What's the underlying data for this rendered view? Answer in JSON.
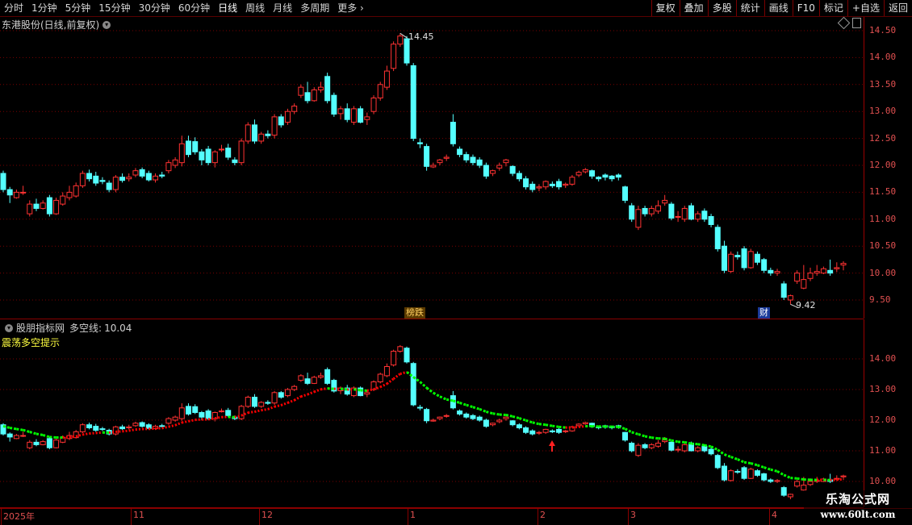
{
  "toolbar": {
    "periods": [
      "分时",
      "1分钟",
      "5分钟",
      "15分钟",
      "30分钟",
      "60分钟",
      "日线",
      "周线",
      "月线",
      "多周期",
      "更多"
    ],
    "active": "日线",
    "right_buttons": [
      "复权",
      "叠加",
      "多股",
      "统计",
      "画线",
      "F10",
      "标记",
      "+自选",
      "返回"
    ]
  },
  "main": {
    "title": "东港股份(日线,前复权)",
    "high_label": "14.45",
    "low_label": "9.42",
    "tag_limit": "榜跌",
    "tag_fin": "财",
    "y_ticks": [
      "14.50",
      "14.00",
      "13.50",
      "13.00",
      "12.50",
      "12.00",
      "11.50",
      "11.00",
      "10.50",
      "10.00",
      "9.50"
    ]
  },
  "indicator": {
    "name": "股朋指标网",
    "line_label": "多空线:",
    "line_value": "10.04",
    "subtitle": "震荡多空提示",
    "y_ticks": [
      "14.00",
      "13.00",
      "12.00",
      "11.00",
      "10.00"
    ]
  },
  "xaxis": {
    "labels": [
      "2025年",
      "11",
      "12",
      "1",
      "2",
      "3",
      "4"
    ]
  },
  "watermark": {
    "line1": "乐淘公式网",
    "line2": "www.60lt.com"
  },
  "colors": {
    "up": "#ff3232",
    "down": "#54ffff",
    "grid": "#7a0000",
    "bull": "#ff0000",
    "bear": "#00ff00"
  },
  "chart_data": {
    "type": "candlestick",
    "x": [
      1,
      2,
      3,
      4,
      5,
      6,
      7,
      8,
      9,
      10,
      11,
      12,
      13,
      14,
      15,
      16,
      17,
      18,
      19,
      20,
      21,
      22,
      23,
      24,
      25,
      26,
      27,
      28,
      29,
      30,
      31,
      32,
      33,
      34,
      35,
      36,
      37,
      38,
      39,
      40,
      41,
      42,
      43,
      44,
      45,
      46,
      47,
      48,
      49,
      50,
      51,
      52,
      53,
      54,
      55,
      56,
      57,
      58,
      59,
      60,
      61,
      62,
      63,
      64,
      65,
      66,
      67,
      68,
      69,
      70,
      71,
      72,
      73,
      74,
      75,
      76,
      77,
      78,
      79,
      80,
      81,
      82,
      83,
      84,
      85,
      86,
      87,
      88,
      89,
      90,
      91,
      92,
      93,
      94,
      95,
      96,
      97,
      98,
      99,
      100,
      101,
      102,
      103,
      104,
      105,
      106,
      107,
      108,
      109,
      110,
      111,
      112,
      113,
      114,
      115,
      116,
      117,
      118,
      119,
      120,
      121,
      122,
      123,
      124,
      125,
      126,
      127,
      128
    ],
    "open": [
      11.85,
      11.55,
      11.4,
      11.5,
      11.1,
      11.28,
      11.2,
      11.4,
      11.1,
      11.28,
      11.4,
      11.43,
      11.62,
      11.85,
      11.8,
      11.72,
      11.67,
      11.55,
      11.78,
      11.75,
      11.82,
      11.92,
      11.85,
      11.73,
      11.82,
      11.9,
      12.0,
      12.05,
      12.45,
      12.44,
      12.25,
      12.3,
      12.05,
      12.3,
      12.32,
      12.1,
      12.05,
      12.45,
      12.75,
      12.45,
      12.58,
      12.56,
      12.9,
      12.8,
      13.0,
      13.3,
      13.35,
      13.2,
      13.4,
      13.65,
      13.3,
      12.96,
      13.05,
      12.8,
      13.05,
      12.85,
      13.0,
      13.25,
      13.45,
      13.8,
      14.25,
      14.35,
      13.85,
      12.42,
      12.35,
      11.97,
      12.05,
      12.13,
      12.8,
      12.3,
      12.2,
      12.15,
      12.1,
      12.0,
      11.85,
      11.95,
      12.05,
      11.98,
      11.85,
      11.75,
      11.65,
      11.58,
      11.6,
      11.65,
      11.7,
      11.63,
      11.65,
      11.82,
      11.88,
      11.9,
      11.78,
      11.82,
      11.8,
      11.82,
      11.6,
      11.25,
      10.85,
      11.2,
      11.1,
      11.15,
      11.3,
      11.28,
      11.05,
      11.0,
      11.25,
      11.0,
      11.15,
      11.05,
      10.85,
      10.5,
      10.03,
      10.33,
      10.45,
      10.1,
      10.35,
      10.25,
      10.05,
      10.0,
      9.8,
      9.5,
      9.85,
      9.72,
      9.9,
      10.0,
      10.0,
      10.05,
      10.08,
      10.15
    ],
    "close": [
      11.55,
      11.45,
      11.5,
      11.5,
      11.28,
      11.2,
      11.3,
      11.1,
      11.35,
      11.43,
      11.5,
      11.62,
      11.85,
      11.75,
      11.67,
      11.7,
      11.55,
      11.78,
      11.72,
      11.78,
      11.9,
      11.8,
      11.73,
      11.8,
      11.8,
      12.05,
      12.1,
      12.4,
      12.2,
      12.25,
      12.1,
      12.05,
      12.25,
      12.3,
      12.15,
      12.05,
      12.45,
      12.75,
      12.45,
      12.58,
      12.55,
      12.9,
      12.75,
      13.0,
      13.1,
      13.45,
      13.2,
      13.4,
      13.45,
      13.2,
      12.95,
      13.05,
      12.85,
      13.05,
      12.8,
      12.9,
      13.25,
      13.5,
      13.75,
      14.25,
      14.4,
      13.9,
      12.5,
      12.4,
      11.98,
      12.0,
      12.1,
      12.15,
      12.4,
      12.2,
      12.1,
      12.05,
      12.0,
      11.8,
      11.9,
      12.0,
      12.1,
      11.85,
      11.75,
      11.6,
      11.55,
      11.6,
      11.7,
      11.62,
      11.6,
      11.65,
      11.78,
      11.87,
      11.92,
      11.8,
      11.75,
      11.78,
      11.75,
      11.78,
      11.35,
      11.0,
      11.18,
      11.1,
      11.2,
      11.25,
      11.35,
      11.02,
      11.05,
      11.2,
      11.0,
      11.1,
      11.0,
      10.9,
      10.45,
      10.05,
      10.35,
      10.3,
      10.1,
      10.4,
      10.2,
      10.05,
      10.0,
      10.03,
      9.55,
      9.58,
      10.0,
      9.88,
      10.0,
      10.03,
      10.08,
      10.0,
      10.1,
      10.18
    ],
    "high": [
      11.9,
      11.6,
      11.55,
      11.62,
      11.35,
      11.38,
      11.35,
      11.45,
      11.4,
      11.5,
      11.62,
      11.68,
      11.9,
      11.92,
      11.88,
      11.78,
      11.72,
      11.82,
      11.85,
      11.85,
      11.95,
      11.96,
      11.9,
      11.85,
      11.88,
      12.1,
      12.15,
      12.55,
      12.55,
      12.52,
      12.3,
      12.36,
      12.28,
      12.38,
      12.4,
      12.15,
      12.5,
      12.8,
      12.85,
      12.62,
      12.65,
      12.95,
      12.95,
      13.05,
      13.15,
      13.5,
      13.55,
      13.45,
      13.55,
      13.72,
      13.35,
      13.1,
      13.15,
      13.1,
      13.1,
      12.98,
      13.3,
      13.55,
      13.85,
      14.3,
      14.45,
      14.4,
      13.9,
      12.5,
      12.4,
      12.05,
      12.12,
      12.2,
      12.95,
      12.35,
      12.25,
      12.2,
      12.15,
      12.05,
      11.92,
      12.05,
      12.12,
      12.0,
      11.9,
      11.8,
      11.7,
      11.65,
      11.72,
      11.7,
      11.75,
      11.68,
      11.82,
      11.9,
      11.95,
      11.92,
      11.8,
      11.85,
      11.82,
      11.85,
      11.62,
      11.3,
      11.25,
      11.25,
      11.25,
      11.35,
      11.45,
      11.32,
      11.15,
      11.25,
      11.3,
      11.15,
      11.2,
      11.1,
      10.9,
      10.6,
      10.4,
      10.4,
      10.5,
      10.45,
      10.4,
      10.28,
      10.1,
      10.08,
      9.85,
      9.6,
      10.05,
      10.15,
      10.1,
      10.15,
      10.12,
      10.25,
      10.2,
      10.22
    ],
    "low": [
      11.5,
      11.3,
      11.38,
      11.45,
      11.05,
      11.15,
      11.18,
      11.05,
      11.08,
      11.25,
      11.35,
      11.4,
      11.58,
      11.7,
      11.62,
      11.65,
      11.5,
      11.5,
      11.68,
      11.7,
      11.78,
      11.76,
      11.7,
      11.68,
      11.76,
      11.85,
      11.95,
      11.98,
      12.15,
      12.2,
      12.0,
      12.0,
      11.96,
      12.25,
      12.1,
      12.0,
      12.0,
      12.4,
      12.4,
      12.4,
      12.5,
      12.5,
      12.7,
      12.75,
      12.95,
      13.25,
      13.15,
      13.18,
      13.35,
      13.15,
      12.9,
      12.85,
      12.8,
      12.75,
      12.78,
      12.75,
      12.95,
      13.2,
      13.4,
      13.75,
      14.2,
      13.85,
      12.45,
      12.32,
      11.9,
      11.95,
      12.0,
      12.08,
      12.35,
      12.15,
      12.05,
      12.0,
      11.95,
      11.75,
      11.8,
      11.9,
      11.98,
      11.8,
      11.7,
      11.55,
      11.5,
      11.52,
      11.55,
      11.58,
      11.55,
      11.58,
      11.62,
      11.78,
      11.85,
      11.75,
      11.7,
      11.72,
      11.7,
      11.72,
      11.3,
      10.95,
      10.8,
      11.05,
      11.05,
      11.1,
      11.25,
      10.98,
      10.95,
      10.95,
      10.98,
      10.95,
      10.95,
      10.85,
      10.4,
      10.0,
      10.0,
      10.25,
      10.05,
      10.08,
      10.15,
      10.0,
      9.95,
      9.95,
      9.5,
      9.42,
      9.8,
      9.7,
      9.85,
      9.95,
      9.98,
      9.95,
      10.02,
      10.05
    ]
  }
}
